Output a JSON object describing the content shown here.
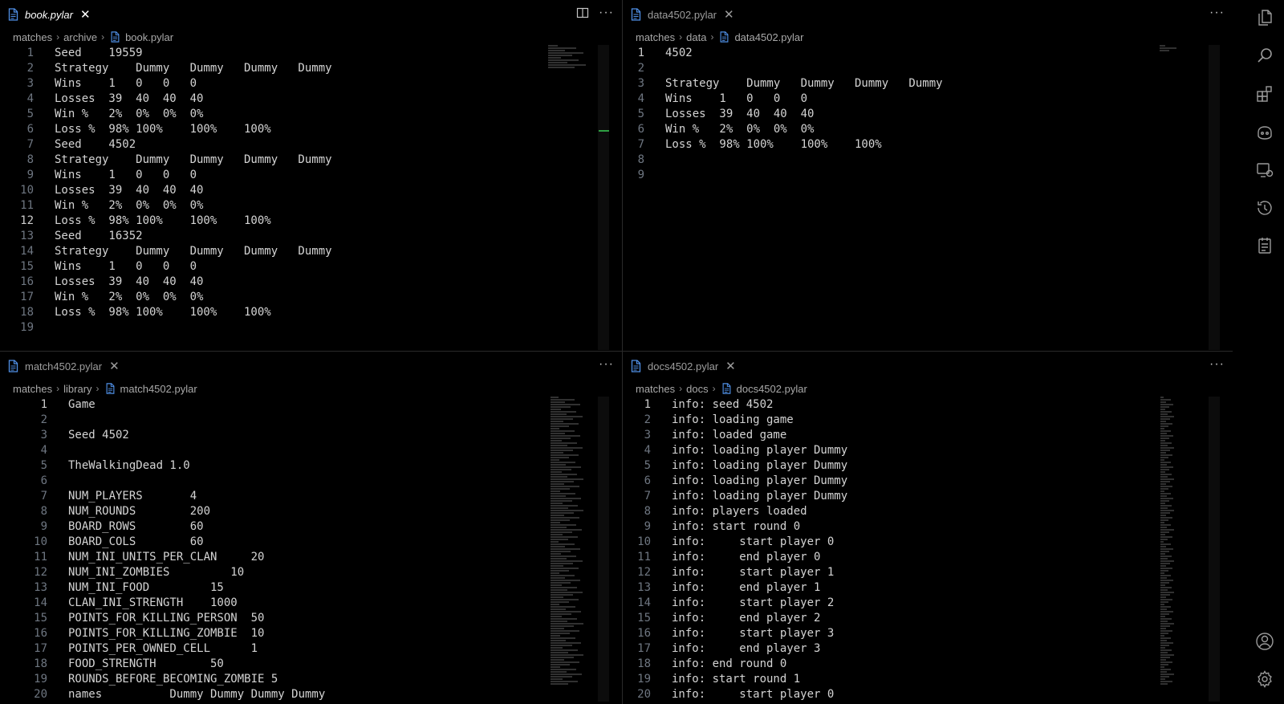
{
  "panes": [
    {
      "tab": {
        "label": "book.pylar",
        "active": true
      },
      "breadcrumb": [
        "matches",
        "archive",
        "book.pylar"
      ],
      "current_line": 12,
      "lines": [
        "Seed    19559",
        "Strategy    Dummy   Dummy   Dummy   Dummy",
        "Wins    1   0   0   0",
        "Losses  39  40  40  40",
        "Win %   2%  0%  0%  0%",
        "Loss %  98% 100%    100%    100%",
        "Seed    4502",
        "Strategy    Dummy   Dummy   Dummy   Dummy",
        "Wins    1   0   0   0",
        "Losses  39  40  40  40",
        "Win %   2%  0%  0%  0%",
        "Loss %  98% 100%    100%    100%",
        "Seed    16352",
        "Strategy    Dummy   Dummy   Dummy   Dummy",
        "Wins    1   0   0   0",
        "Losses  39  40  40  40",
        "Win %   2%  0%  0%  0%",
        "Loss %  98% 100%    100%    100%",
        ""
      ]
    },
    {
      "tab": {
        "label": "data4502.pylar",
        "active": false
      },
      "breadcrumb": [
        "matches",
        "data",
        "data4502.pylar"
      ],
      "current_line": 1,
      "lines": [
        "4502",
        "",
        "Strategy    Dummy   Dummy   Dummy   Dummy",
        "Wins    1   0   0   0",
        "Losses  39  40  40  40",
        "Win %   2%  0%  0%  0%",
        "Loss %  98% 100%    100%    100%",
        "",
        ""
      ]
    },
    {
      "tab": {
        "label": "match4502.pylar",
        "active": false
      },
      "breadcrumb": [
        "matches",
        "library",
        "match4502.pylar"
      ],
      "current_line": 1,
      "lines": [
        "Game",
        "",
        "Seed 4502",
        "",
        "TheWalkingDead 1.0",
        "",
        "NUM_PLAYERS       4",
        "NUM_ROUNDS        200",
        "BOARD_ROWS        60",
        "BOARD_COLS        60",
        "NUM_INI_UNITS_PER_CLAN     20",
        "NUM_INI_ZOMBIES         10",
        "NUM_INI_FOOD         15",
        "CLAN_INI_STRENGTH    1000",
        "POINTS_FOR_KILLING_PERSON  50",
        "POINTS_FOR_KILLING_ZOMBIE  10",
        "POINTS_PER_OWNED_CELL      1",
        "FOOD_STRENGTH        50",
        "ROUNDS_BEFORE_BECOMING_ZOMBIE 5",
        "names          Dummy Dummy Dummy Dummy"
      ]
    },
    {
      "tab": {
        "label": "docs4502.pylar",
        "active": false
      },
      "breadcrumb": [
        "matches",
        "docs",
        "docs4502.pylar"
      ],
      "current_line": 1,
      "lines": [
        "info: seed 4502",
        "info: loading game",
        "info: loaded game",
        "info: loading player Dummy",
        "info: loading player Dummy",
        "info: loading player Dummy",
        "info: loading player Dummy",
        "info: players loaded",
        "info: start round 0",
        "info:     start player 0",
        "info:     end player 0",
        "info:     start player 1",
        "info:     end player 1",
        "info:     start player 2",
        "info:     end player 2",
        "info:     start player 3",
        "info:     end player 3",
        "info: end round 0",
        "info: start round 1",
        "info:     start player 0"
      ]
    }
  ],
  "activity_bar": [
    "explorer-icon",
    "search-icon",
    "extensions-icon",
    "copilot-icon",
    "remote-explorer-icon",
    "timeline-icon",
    "notes-icon",
    "account-icon",
    "settings-gear-icon"
  ],
  "colors": {
    "background": "#000000",
    "text": "#d4d4d4",
    "line_number": "#6e7681",
    "file_icon": "#4f8fe6"
  }
}
